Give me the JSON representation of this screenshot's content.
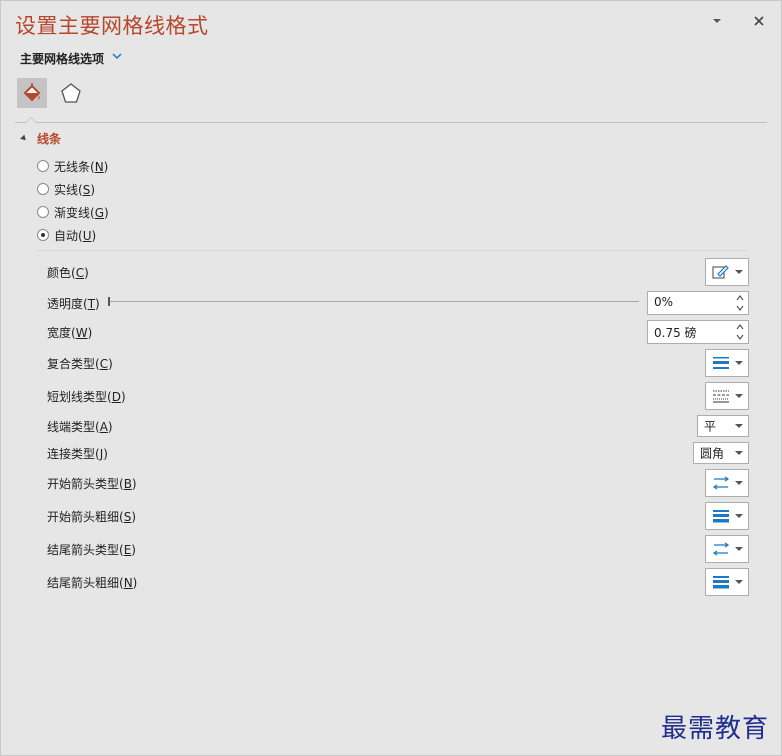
{
  "header": {
    "title": "设置主要网格线格式",
    "dropdown_icon": "chevron-down-icon",
    "close_icon": "close-icon"
  },
  "options": {
    "label": "主要网格线选项"
  },
  "tabs": [
    {
      "name": "fill-line",
      "icon": "paint-bucket-icon",
      "active": true
    },
    {
      "name": "effects",
      "icon": "pentagon-icon",
      "active": false
    }
  ],
  "section": {
    "title": "线条"
  },
  "line_type": {
    "options": [
      {
        "text": "无线条(",
        "key": "N",
        "selected": false
      },
      {
        "text": "实线(",
        "key": "S",
        "selected": false
      },
      {
        "text": "渐变线(",
        "key": "G",
        "selected": false
      },
      {
        "text": "自动(",
        "key": "U",
        "selected": true
      }
    ]
  },
  "props": {
    "color": {
      "text": "颜色(",
      "key": "C"
    },
    "transparency": {
      "text": "透明度(",
      "key": "T",
      "value": "0%"
    },
    "width": {
      "text": "宽度(",
      "key": "W",
      "value": "0.75 磅"
    },
    "compound": {
      "text": "复合类型(",
      "key": "C"
    },
    "dash": {
      "text": "短划线类型(",
      "key": "D"
    },
    "cap": {
      "text": "线端类型(",
      "key": "A",
      "value": "平"
    },
    "join": {
      "text": "连接类型(",
      "key": "J",
      "value": "圆角"
    },
    "begin_arrow_type": {
      "text": "开始箭头类型(",
      "key": "B"
    },
    "begin_arrow_size": {
      "text": "开始箭头粗细(",
      "key": "S"
    },
    "end_arrow_type": {
      "text": "结尾箭头类型(",
      "key": "E"
    },
    "end_arrow_size": {
      "text": "结尾箭头粗细(",
      "key": "N"
    }
  },
  "close_paren": ")",
  "colors": {
    "title": "#b7472a",
    "accent": "#1e78c8"
  },
  "watermark": "最需教育"
}
